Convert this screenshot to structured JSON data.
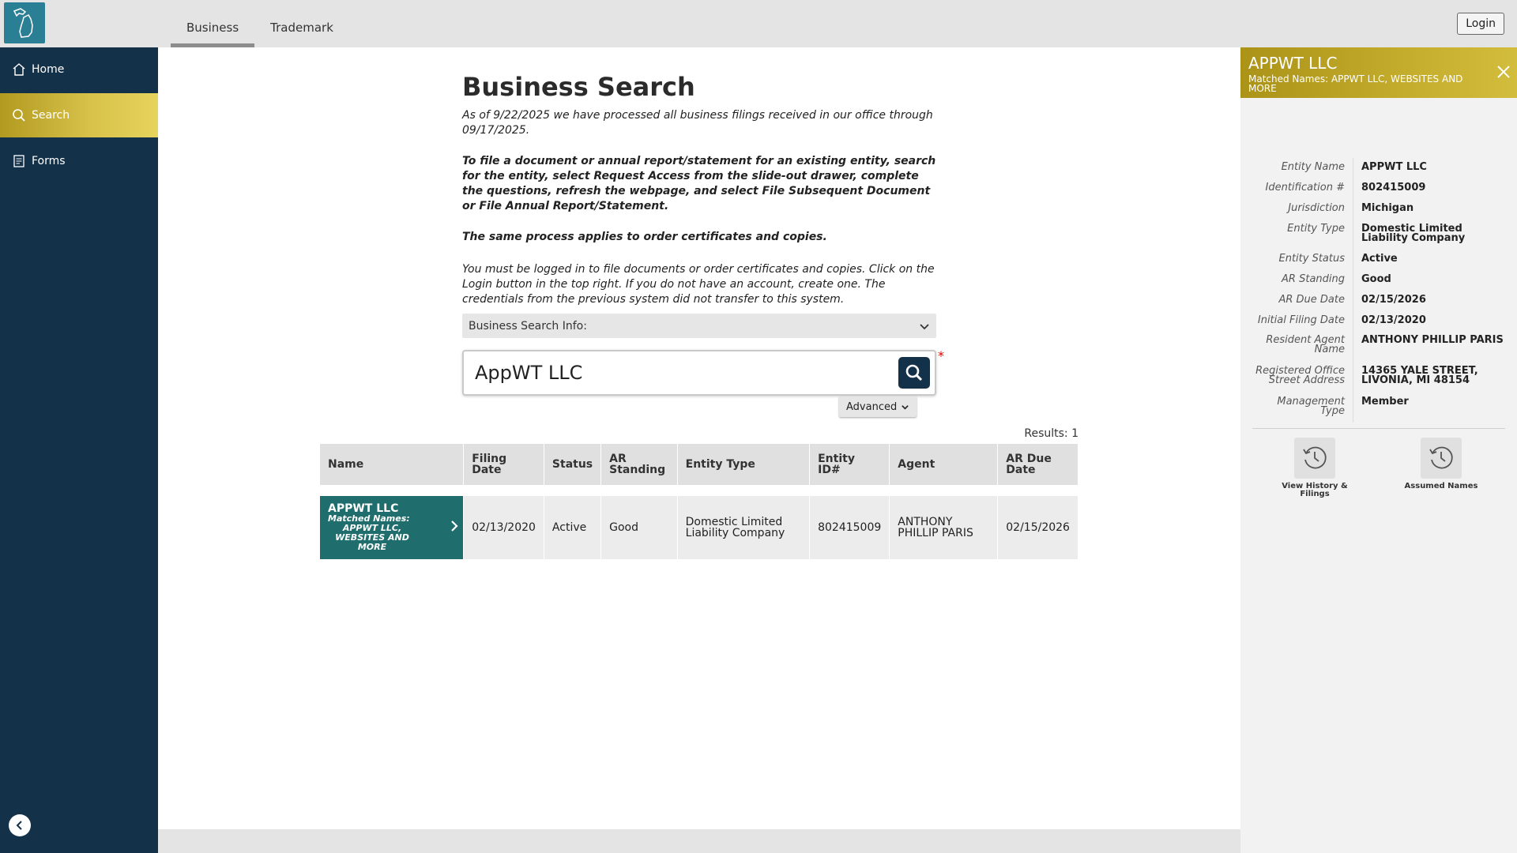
{
  "topbar": {
    "tabs": [
      "Business",
      "Trademark"
    ],
    "login_label": "Login"
  },
  "sidebar": {
    "items": [
      {
        "label": "Home",
        "icon": "home-icon"
      },
      {
        "label": "Search",
        "icon": "search-icon"
      },
      {
        "label": "Forms",
        "icon": "forms-icon"
      }
    ]
  },
  "main": {
    "title": "Business Search",
    "para1": "As of 9/22/2025 we have processed all business filings received in our office through 09/17/2025.",
    "para2": "To file a document or annual report/statement for an existing entity, search for the entity, select Request Access from the slide-out drawer, complete the questions, refresh the webpage, and select File Subsequent Document or File Annual Report/Statement.",
    "para3": "The same process applies to order certificates and copies.",
    "para4": "You must be logged in to file documents or order certificates and copies. Click on the Login button in the top right. If you do not have an account, create one. The credentials from the previous system did not transfer to this system.",
    "info_bar_label": "Business Search Info:",
    "search_value": "AppWT LLC",
    "required_mark": "*",
    "advanced_label": "Advanced",
    "results_label": "Results: 1"
  },
  "table": {
    "headers": [
      "Name",
      "Filing Date",
      "Status",
      "AR Standing",
      "Entity Type",
      "Entity ID#",
      "Agent",
      "AR Due Date"
    ],
    "row": {
      "name": "APPWT LLC",
      "matched_label": "Matched Names:",
      "matched_names": "APPWT LLC, WEBSITES AND MORE",
      "filing_date": "02/13/2020",
      "status": "Active",
      "ar_standing": "Good",
      "entity_type": "Domestic Limited Liability Company",
      "entity_id": "802415009",
      "agent": "ANTHONY PHILLIP PARIS",
      "ar_due_date": "02/15/2026"
    }
  },
  "panel": {
    "title": "APPWT LLC",
    "subtitle": "Matched Names: APPWT LLC, WEBSITES AND MORE",
    "details": [
      {
        "label": "Entity Name",
        "value": "APPWT LLC"
      },
      {
        "label": "Identification #",
        "value": "802415009"
      },
      {
        "label": "Jurisdiction",
        "value": "Michigan"
      },
      {
        "label": "Entity Type",
        "value": "Domestic Limited Liability Company"
      },
      {
        "label": "Entity Status",
        "value": "Active"
      },
      {
        "label": "AR Standing",
        "value": "Good"
      },
      {
        "label": "AR Due Date",
        "value": "02/15/2026"
      },
      {
        "label": "Initial Filing Date",
        "value": "02/13/2020"
      },
      {
        "label": "Resident Agent Name",
        "value": "ANTHONY PHILLIP PARIS"
      },
      {
        "label": "Registered Office Street Address",
        "value": "14365 YALE STREET, LIVONIA, MI 48154"
      },
      {
        "label": "Management Type",
        "value": "Member"
      }
    ],
    "actions": [
      {
        "label": "View History & Filings",
        "icon": "history-icon"
      },
      {
        "label": "Assumed Names",
        "icon": "history-icon"
      }
    ]
  },
  "colors": {
    "sidebar_bg": "#14314a",
    "accent_gold": "#c8b030",
    "row_teal": "#1f6d6c",
    "logo_teal": "#2a7f94"
  }
}
